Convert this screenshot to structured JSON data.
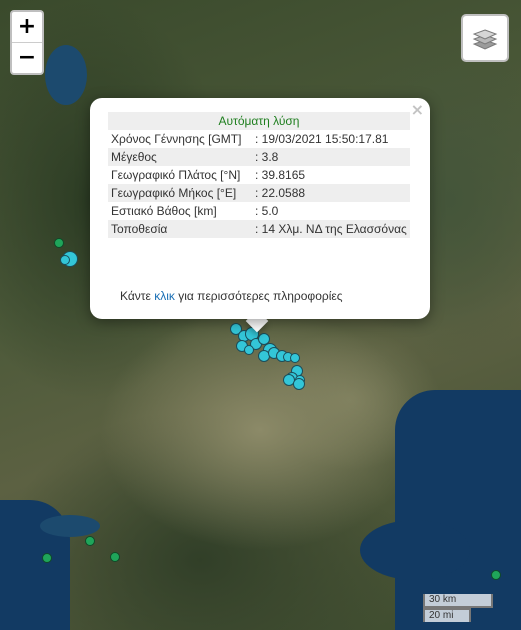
{
  "map": {
    "zoom_in_label": "+",
    "zoom_out_label": "−",
    "layers_icon": "layers-icon",
    "colors": {
      "recent_quake": "#33c6d8",
      "older_quake": "#1fa55a",
      "sea": "#123a63"
    }
  },
  "popup": {
    "close_label": "×",
    "header": "Αυτόματη λύση",
    "rows": [
      {
        "label": "Χρόνος Γέννησης [GMT]",
        "value": ": 19/03/2021 15:50:17.81"
      },
      {
        "label": "Μέγεθος",
        "value": ": 3.8"
      },
      {
        "label": "Γεωγραφικό Πλάτος [°N]",
        "value": ": 39.8165"
      },
      {
        "label": "Γεωγραφικό Μήκος [°E]",
        "value": ": 22.0588"
      },
      {
        "label": "Εστιακό Βάθος [km]",
        "value": ": 5.0"
      },
      {
        "label": "Τοποθεσία",
        "value": ": 14 Χλμ. ΝΔ της Ελασσόνας"
      }
    ],
    "footer_before": "Κάντε ",
    "footer_link": "κλικ",
    "footer_after": " για περισσότερες πληροφορίες"
  },
  "scale": {
    "km": "30 km",
    "mi": "20 mi"
  }
}
